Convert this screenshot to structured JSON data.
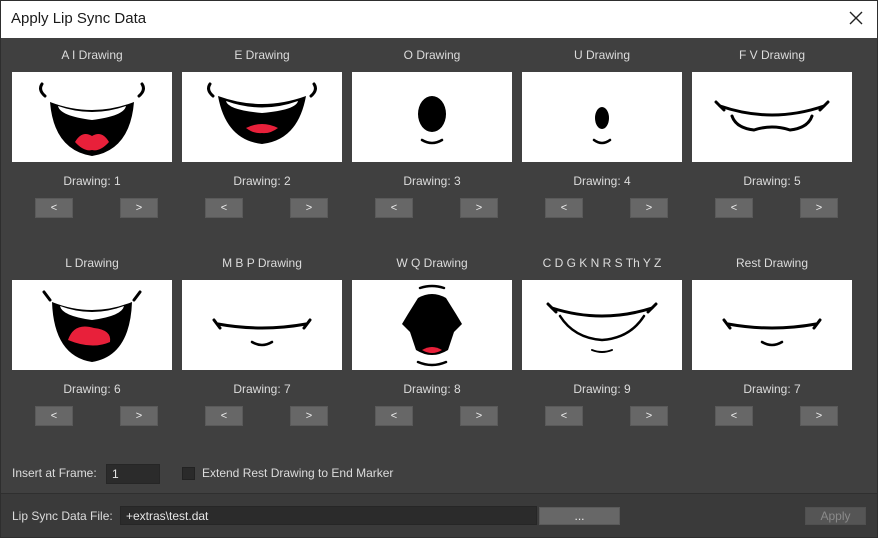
{
  "window": {
    "title": "Apply Lip Sync Data",
    "close_icon": "close-icon"
  },
  "cells": [
    {
      "title": "A I Drawing",
      "drawing": "Drawing: 1",
      "prev": "<",
      "next": ">"
    },
    {
      "title": "E Drawing",
      "drawing": "Drawing: 2",
      "prev": "<",
      "next": ">"
    },
    {
      "title": "O Drawing",
      "drawing": "Drawing: 3",
      "prev": "<",
      "next": ">"
    },
    {
      "title": "U Drawing",
      "drawing": "Drawing: 4",
      "prev": "<",
      "next": ">"
    },
    {
      "title": "F V Drawing",
      "drawing": "Drawing: 5",
      "prev": "<",
      "next": ">"
    },
    {
      "title": "L Drawing",
      "drawing": "Drawing: 6",
      "prev": "<",
      "next": ">"
    },
    {
      "title": "M B P Drawing",
      "drawing": "Drawing: 7",
      "prev": "<",
      "next": ">"
    },
    {
      "title": "W Q Drawing",
      "drawing": "Drawing: 8",
      "prev": "<",
      "next": ">"
    },
    {
      "title": "C D G K N R S Th Y Z",
      "drawing": "Drawing: 9",
      "prev": "<",
      "next": ">"
    },
    {
      "title": "Rest Drawing",
      "drawing": "Drawing: 7",
      "prev": "<",
      "next": ">"
    }
  ],
  "options": {
    "insert_label": "Insert at Frame:",
    "insert_value": "1",
    "extend_label": "Extend Rest Drawing to End Marker",
    "extend_checked": false
  },
  "footer": {
    "file_label": "Lip Sync Data File:",
    "file_value": "+extras\\test.dat",
    "browse_label": "...",
    "apply_label": "Apply"
  },
  "colors": {
    "background": "#404040",
    "button": "#676767",
    "mouth_red": "#e8203a"
  }
}
